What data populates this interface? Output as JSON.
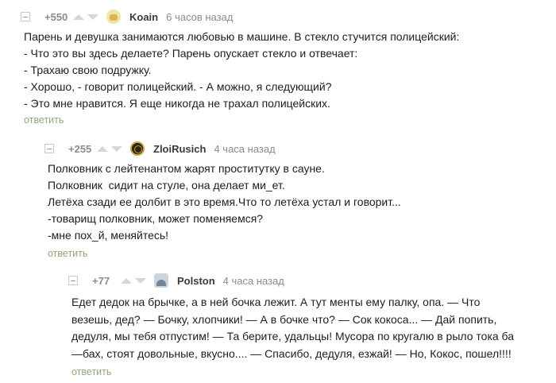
{
  "comments": [
    {
      "rating": "+550",
      "author": "Koain",
      "time": "6 часов назад",
      "lines": [
        "Парень и девушка занимаются любовью в машине. В стекло стучится полицейский:",
        "- Что это вы здесь делаете? Парень опускает стекло и отвечает:",
        "- Трахаю свою подружку.",
        "- Хорошо, - говорит полицейский. - А можно, я следующий?",
        "- Это мне нравится. Я еще никогда не трахал полицейских."
      ],
      "reply_label": "ответить"
    },
    {
      "rating": "+255",
      "author": "ZloiRusich",
      "time": "4 часа назад",
      "lines": [
        "Полковник с лейтенантом жарят проститутку в сауне.",
        "Полковник  сидит на стуле, она делает ми_ет.",
        "Летёха сзади ее долбит в это время.Что то летёха устал и говорит...",
        "-товарищ полковник, может поменяемся?",
        "-мне пох_й, меняйтесь!"
      ],
      "reply_label": "ответить"
    },
    {
      "rating": "+77",
      "author": "Polston",
      "time": "4 часа назад",
      "lines": [
        "Едет дедок на брычке, а в ней бочка лежит. А тут менты ему палку, опа. — Что",
        "везешь, дед? — Бочку, хлопчики! — А в бочке что? — Сок кокоса... — Дай попить,",
        "дедуля, мы тебя отпустим! — Та берите, удальцы! Мусора по кругалю в рыло тока ба",
        "—бах, стоят довольные, вкусно.... — Спасибо, дедуля, езжай! — Но, Кокос, пошел!!!!"
      ],
      "reply_label": "ответить"
    }
  ],
  "icons": {
    "collapse": "collapse-icon",
    "upvote": "upvote-icon",
    "downvote": "downvote-icon"
  }
}
